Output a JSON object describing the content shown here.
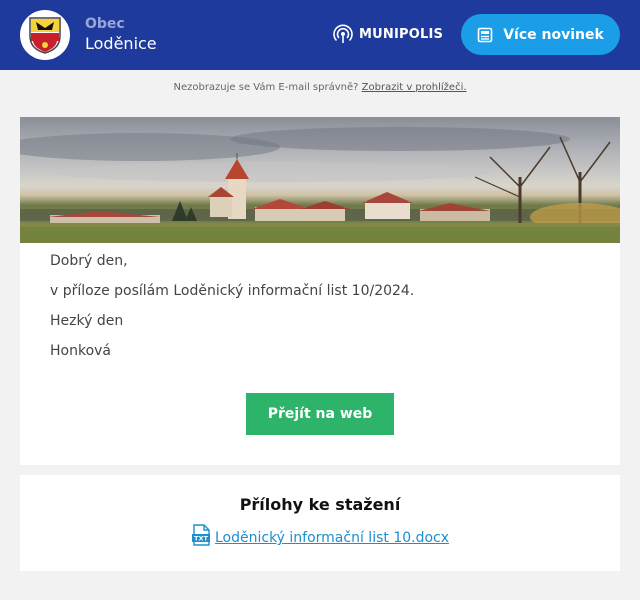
{
  "header": {
    "org_prefix": "Obec",
    "org_name": "Loděnice",
    "brand_name": "MUNIPOLIS",
    "more_news_label": "Více novinek"
  },
  "notice": {
    "text": "Nezobrazuje se Vám E-mail správně?",
    "link_label": "Zobrazit v prohlížeči."
  },
  "message": {
    "greeting": "Dobrý den,",
    "body": "v příloze posílám Loděnický informační list 10/2024.",
    "closing": "Hezký den",
    "signature": "Honková"
  },
  "cta": {
    "label": "Přejít na web"
  },
  "attachments": {
    "title": "Přílohy ke stažení",
    "items": [
      {
        "icon": "txt-file-icon",
        "name": "Loděnický informační list 10.docx"
      }
    ]
  },
  "colors": {
    "header_bg": "#1e3a9c",
    "primary_button": "#1b9de8",
    "cta_button": "#2db36a",
    "link": "#1b8fd0"
  }
}
